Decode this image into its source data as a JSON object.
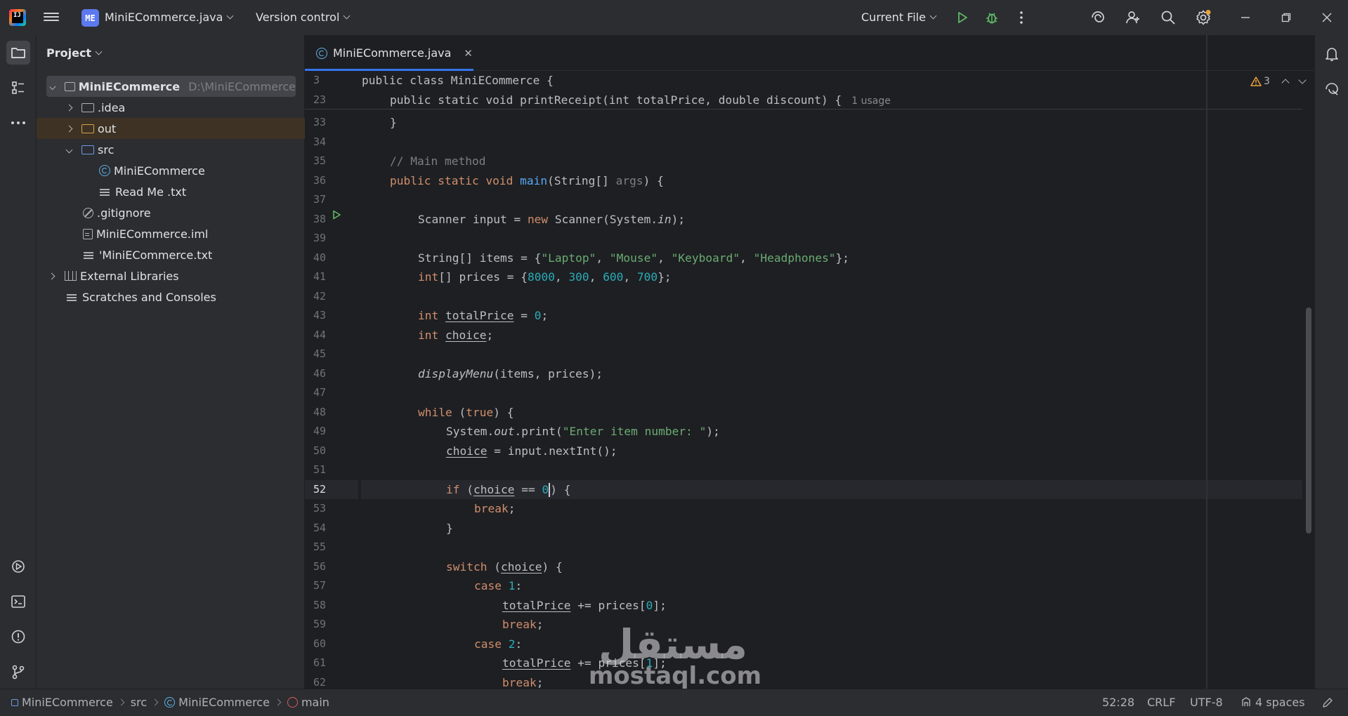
{
  "titlebar": {
    "logo_text": "IJ",
    "project_badge": "ME",
    "project_name": "MiniECommerce.java",
    "version_control": "Version control",
    "run_config": "Current File"
  },
  "project_panel": {
    "title": "Project",
    "tree": [
      {
        "label": "MiniECommerce",
        "hint": "D:\\MiniECommerce"
      },
      {
        "label": ".idea"
      },
      {
        "label": "out"
      },
      {
        "label": "src"
      },
      {
        "label": "MiniECommerce"
      },
      {
        "label": "Read Me .txt"
      },
      {
        "label": ".gitignore"
      },
      {
        "label": "MiniECommerce.iml"
      },
      {
        "label": "'MiniECommerce.txt"
      },
      {
        "label": "External Libraries"
      },
      {
        "label": "Scratches and Consoles"
      }
    ]
  },
  "editor": {
    "tab_label": "MiniECommerce.java",
    "warning_count": "3",
    "sticky": [
      {
        "num": "3",
        "code": "public class MiniECommerce {"
      },
      {
        "num": "23",
        "code": "public static void printReceipt(int totalPrice, double discount) {",
        "hint": "1 usage"
      }
    ],
    "line_numbers": [
      "33",
      "34",
      "35",
      "36",
      "37",
      "38",
      "39",
      "40",
      "41",
      "42",
      "43",
      "44",
      "45",
      "46",
      "47",
      "48",
      "49",
      "50",
      "51",
      "52",
      "53",
      "54",
      "55",
      "56",
      "57",
      "58",
      "59",
      "60",
      "61",
      "62"
    ],
    "lines": {
      "l33": "}",
      "l35": "// Main method",
      "l36_a": "public static void ",
      "l36_fn": "main",
      "l36_b": "(String[] ",
      "l36_args": "args",
      "l36_c": ") {",
      "l38_a": "Scanner input = ",
      "l38_kw": "new",
      "l38_b": " Scanner(System.",
      "l38_in": "in",
      "l38_c": ");",
      "l40_a": "String[] items = {",
      "l40_s1": "\"Laptop\"",
      "l40_s2": "\"Mouse\"",
      "l40_s3": "\"Keyboard\"",
      "l40_s4": "\"Headphones\"",
      "l40_end": "};",
      "l41_kw": "int",
      "l41_a": "[] prices = {",
      "l41_n1": "8000",
      "l41_n2": "300",
      "l41_n3": "600",
      "l41_n4": "700",
      "l41_end": "};",
      "l43_kw": "int",
      "l43_var": "totalPrice",
      "l43_a": " = ",
      "l43_n": "0",
      "l43_end": ";",
      "l44_kw": "int",
      "l44_var": "choice",
      "l44_end": ";",
      "l46_fn": "displayMenu",
      "l46_a": "(items, prices);",
      "l48_kw": "while",
      "l48_a": " (",
      "l48_kw2": "true",
      "l48_b": ") {",
      "l49_a": "System.",
      "l49_out": "out",
      "l49_b": ".print(",
      "l49_s": "\"Enter item number: \"",
      "l49_c": ");",
      "l50_var": "choice",
      "l50_a": " = input.nextInt();",
      "l52_kw": "if",
      "l52_a": " (",
      "l52_var": "choice",
      "l52_b": " == ",
      "l52_n": "0",
      "l52_c": ") {",
      "l53_kw": "break",
      "l53_a": ";",
      "l54": "}",
      "l56_kw": "switch",
      "l56_a": " (",
      "l56_var": "choice",
      "l56_b": ") {",
      "l57_kw": "case",
      "l57_n": "1",
      "l57_a": ":",
      "l58_var": "totalPrice",
      "l58_a": " += prices[",
      "l58_n": "0",
      "l58_b": "];",
      "l59_kw": "break",
      "l59_a": ";",
      "l60_kw": "case",
      "l60_n": "2",
      "l60_a": ":",
      "l61_var": "totalPrice",
      "l61_a": " += prices[",
      "l61_n": "1",
      "l61_b": "];",
      "l62_kw": "break",
      "l62_a": ";"
    }
  },
  "statusbar": {
    "breadcrumb": [
      "MiniECommerce",
      "src",
      "MiniECommerce",
      "main"
    ],
    "position": "52:28",
    "line_sep": "CRLF",
    "encoding": "UTF-8",
    "indent": "4 spaces"
  },
  "watermark": {
    "arabic": "مستقل",
    "latin": "mostaql.com"
  },
  "colors": {
    "accent": "#3574f0",
    "keyword": "#cf8e6d",
    "function": "#56a8f5",
    "string": "#6aab73",
    "number": "#2aacb8",
    "comment": "#7a7e85"
  }
}
